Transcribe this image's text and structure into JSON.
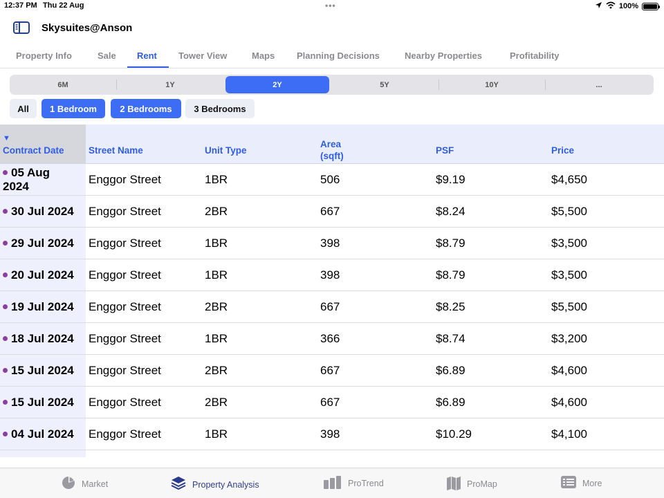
{
  "status_bar": {
    "time": "12:37 PM",
    "date": "Thu 22 Aug",
    "battery": "100%",
    "dots": "•••"
  },
  "header": {
    "title": "Skysuites@Anson",
    "sidebar_icon": "sidebar-icon"
  },
  "tabs": [
    {
      "label": "Property Info",
      "active": false
    },
    {
      "label": "Sale",
      "active": false
    },
    {
      "label": "Rent",
      "active": true
    },
    {
      "label": "Tower View",
      "active": false
    },
    {
      "label": "Maps",
      "active": false
    },
    {
      "label": "Planning Decisions",
      "active": false
    },
    {
      "label": "Nearby Properties",
      "active": false
    },
    {
      "label": "Profitability",
      "active": false
    }
  ],
  "periods": [
    {
      "label": "6M",
      "active": false
    },
    {
      "label": "1Y",
      "active": false
    },
    {
      "label": "2Y",
      "active": true
    },
    {
      "label": "5Y",
      "active": false
    },
    {
      "label": "10Y",
      "active": false
    },
    {
      "label": "...",
      "active": false
    }
  ],
  "filters": [
    {
      "label": "All",
      "active": false
    },
    {
      "label": "1 Bedroom",
      "active": true
    },
    {
      "label": "2 Bedrooms",
      "active": true
    },
    {
      "label": "3 Bedrooms",
      "active": false
    }
  ],
  "table": {
    "sort_indicator": "▼",
    "columns": [
      "Contract Date",
      "Street Name",
      "Unit Type",
      "Area",
      "(sqft)",
      "PSF",
      "Price"
    ],
    "rows": [
      {
        "date": "05 Aug 2024",
        "street": "Enggor Street",
        "unit": "1BR",
        "area": "506",
        "psf": "$9.19",
        "price": "$4,650"
      },
      {
        "date": "30 Jul 2024",
        "street": "Enggor Street",
        "unit": "2BR",
        "area": "667",
        "psf": "$8.24",
        "price": "$5,500"
      },
      {
        "date": "29 Jul 2024",
        "street": "Enggor Street",
        "unit": "1BR",
        "area": "398",
        "psf": "$8.79",
        "price": "$3,500"
      },
      {
        "date": "20 Jul 2024",
        "street": "Enggor Street",
        "unit": "1BR",
        "area": "398",
        "psf": "$8.79",
        "price": "$3,500"
      },
      {
        "date": "19 Jul 2024",
        "street": "Enggor Street",
        "unit": "2BR",
        "area": "667",
        "psf": "$8.25",
        "price": "$5,500"
      },
      {
        "date": "18 Jul 2024",
        "street": "Enggor Street",
        "unit": "1BR",
        "area": "366",
        "psf": "$8.74",
        "price": "$3,200"
      },
      {
        "date": "15 Jul 2024",
        "street": "Enggor Street",
        "unit": "2BR",
        "area": "667",
        "psf": "$6.89",
        "price": "$4,600"
      },
      {
        "date": "15 Jul 2024",
        "street": "Enggor Street",
        "unit": "2BR",
        "area": "667",
        "psf": "$6.89",
        "price": "$4,600"
      },
      {
        "date": "04 Jul 2024",
        "street": "Enggor Street",
        "unit": "1BR",
        "area": "398",
        "psf": "$10.29",
        "price": "$4,100"
      }
    ]
  },
  "bottom_tabs": [
    {
      "label": "Market",
      "icon": "pie-chart-icon",
      "active": false
    },
    {
      "label": "Property Analysis",
      "icon": "layers-icon",
      "active": true
    },
    {
      "label": "ProTrend",
      "icon": "bar-chart-icon",
      "active": false
    },
    {
      "label": "ProMap",
      "icon": "map-icon",
      "active": false
    },
    {
      "label": "More",
      "icon": "list-icon",
      "active": false
    }
  ],
  "colors": {
    "accent": "#3d6df4",
    "header_text": "#2f5de3",
    "date_dot": "#8a3fa0"
  }
}
